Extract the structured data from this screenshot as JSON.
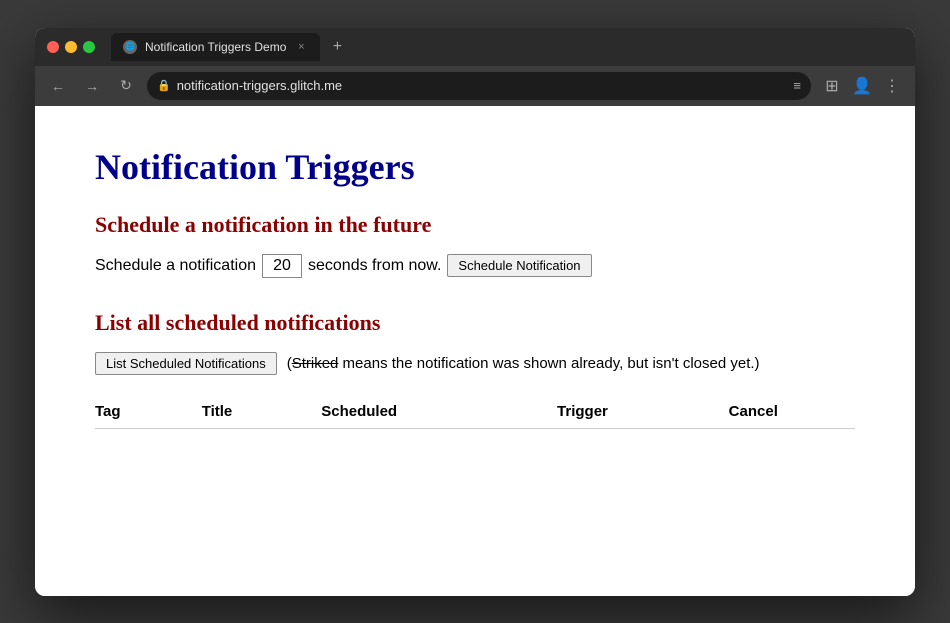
{
  "browser": {
    "tab_favicon": "🌐",
    "tab_title": "Notification Triggers Demo",
    "tab_close": "×",
    "new_tab": "+",
    "nav_back": "←",
    "nav_forward": "→",
    "nav_reload": "↻",
    "address_lock": "🔒",
    "address_url": "notification-triggers.glitch.me",
    "address_menu": "≡",
    "toolbar_extensions": "⊞",
    "toolbar_account": "👤",
    "toolbar_more": "⋮"
  },
  "page": {
    "title": "Notification Triggers",
    "section1_title": "Schedule a notification in the future",
    "schedule_prefix": "Schedule a notification",
    "schedule_value": "20",
    "schedule_suffix": "seconds from now.",
    "schedule_btn": "Schedule Notification",
    "section2_title": "List all scheduled notifications",
    "list_btn": "List Scheduled Notifications",
    "striked_info_prefix": "(",
    "striked_word": "Striked",
    "striked_info_suffix": " means the notification was shown already, but isn't closed yet.)",
    "table_headers": [
      "Tag",
      "Title",
      "Scheduled",
      "Trigger",
      "Cancel"
    ],
    "table_rows": []
  }
}
